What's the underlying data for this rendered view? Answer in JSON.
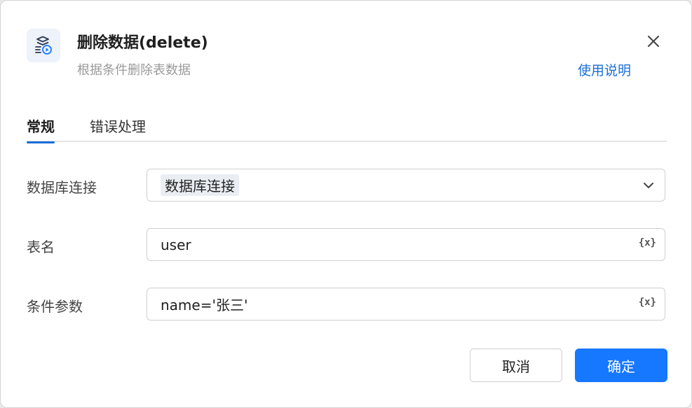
{
  "dialog": {
    "title": "删除数据(delete)",
    "subtitle": "根据条件删除表数据",
    "help_link": "使用说明",
    "icon": "database-delete-icon"
  },
  "tabs": [
    {
      "label": "常规",
      "active": true
    },
    {
      "label": "错误处理",
      "active": false
    }
  ],
  "form": {
    "db_connection": {
      "label": "数据库连接",
      "value": "数据库连接"
    },
    "table_name": {
      "label": "表名",
      "value": "user",
      "var_icon": "{x}"
    },
    "condition": {
      "label": "条件参数",
      "value": "name='张三'",
      "var_icon": "{x}"
    }
  },
  "buttons": {
    "cancel": "取消",
    "ok": "确定"
  },
  "colors": {
    "accent": "#1677ff",
    "link": "#1a6fd8"
  }
}
